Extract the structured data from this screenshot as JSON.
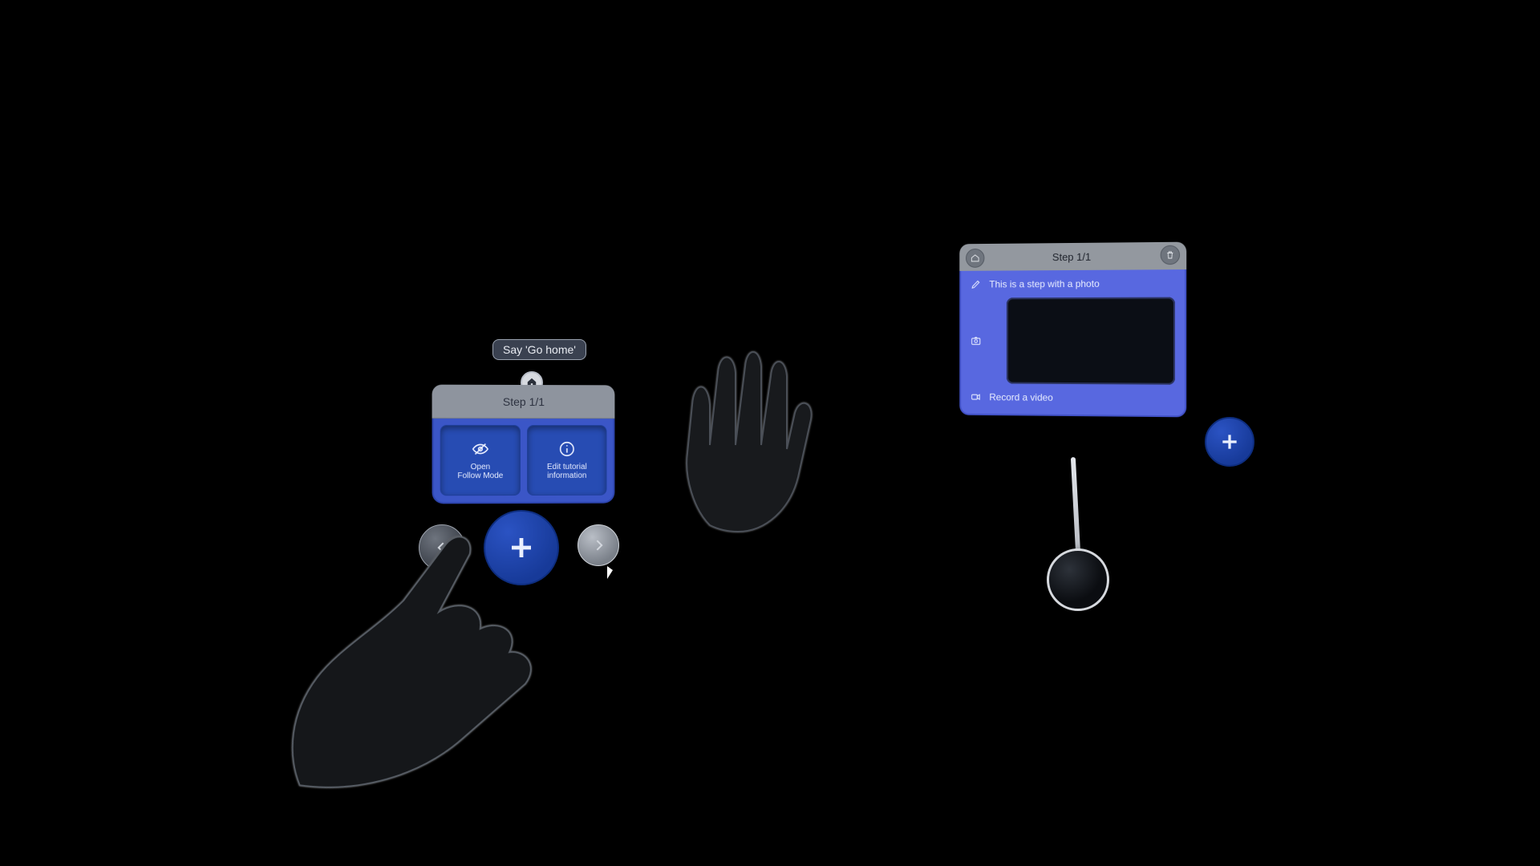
{
  "voiceHint": {
    "text": "Say 'Go home'"
  },
  "leftPanel": {
    "stepLabel": "Step 1/1",
    "openFollow": {
      "line1": "Open",
      "line2": "Follow Mode"
    },
    "editInfo": {
      "line1": "Edit tutorial",
      "line2": "information"
    }
  },
  "rightPanel": {
    "stepLabel": "Step 1/1",
    "description": "This is a step with a photo",
    "recordVideo": "Record a video"
  },
  "colors": {
    "primaryBlue": "#274cb3",
    "panelBlue": "#5868e0",
    "chipBg": "#3a4150"
  }
}
